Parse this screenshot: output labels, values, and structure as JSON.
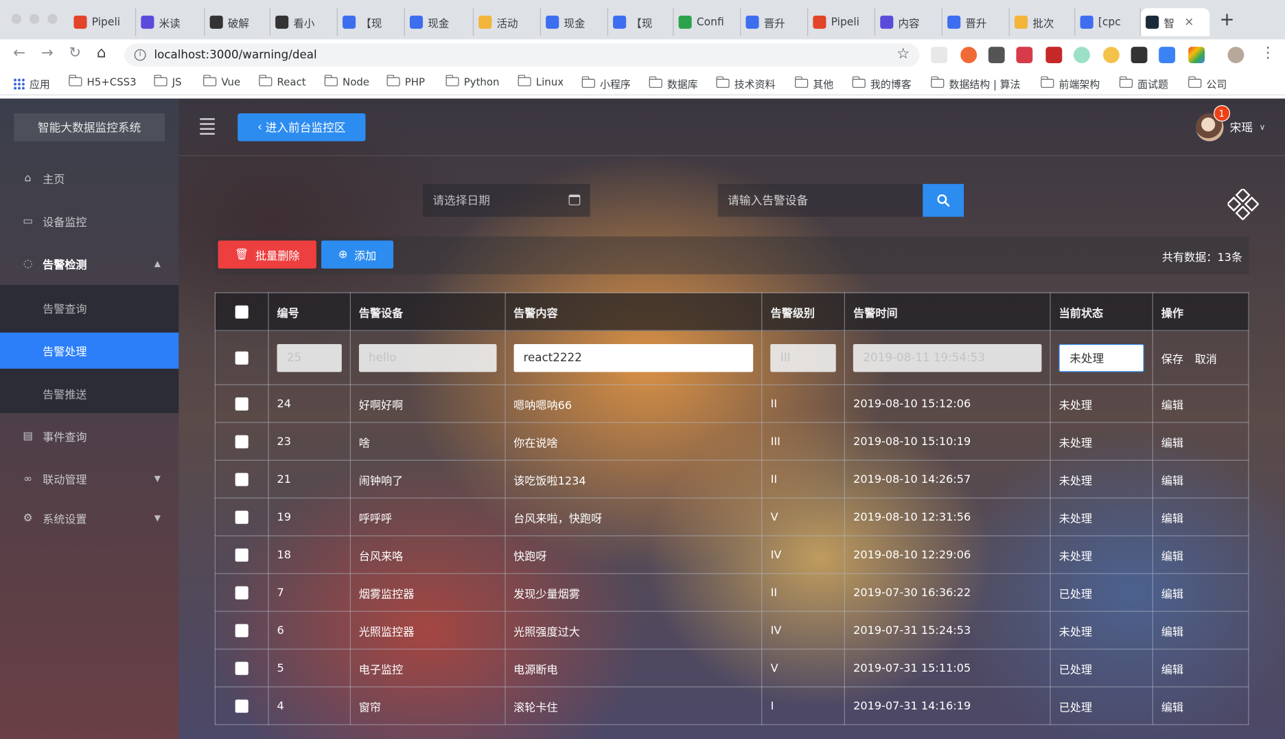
{
  "browser": {
    "tabs": [
      {
        "label": "Pipeli",
        "color": "#e24329"
      },
      {
        "label": "米读",
        "color": "#5b4bdb"
      },
      {
        "label": "破解",
        "color": "#333333"
      },
      {
        "label": "看小",
        "color": "#333333"
      },
      {
        "label": "【现",
        "color": "#3d6ef0"
      },
      {
        "label": "现金",
        "color": "#3d6ef0"
      },
      {
        "label": "活动",
        "color": "#f2b53a"
      },
      {
        "label": "现金",
        "color": "#3d6ef0"
      },
      {
        "label": "【现",
        "color": "#3d6ef0"
      },
      {
        "label": "Confi",
        "color": "#2ca24c"
      },
      {
        "label": "晋升",
        "color": "#3d6ef0"
      },
      {
        "label": "Pipeli",
        "color": "#e24329"
      },
      {
        "label": "内容",
        "color": "#5b4bdb"
      },
      {
        "label": "晋升",
        "color": "#3d6ef0"
      },
      {
        "label": "批次",
        "color": "#f2b53a"
      },
      {
        "label": "[cpc",
        "color": "#3d6ef0"
      },
      {
        "label": "智",
        "color": "#1c2b3a"
      }
    ],
    "url": "localhost:3000/warning/deal",
    "bookmarks": [
      "应用",
      "H5+CSS3",
      "JS",
      "Vue",
      "React",
      "Node",
      "PHP",
      "Python",
      "Linux",
      "小程序",
      "数据库",
      "技术资料",
      "其他",
      "我的博客",
      "数据结构 | 算法",
      "前端架构",
      "面试题",
      "公司"
    ]
  },
  "app": {
    "logo": "智能大数据监控系统",
    "menu": [
      {
        "label": "主页",
        "icon": "home-icon"
      },
      {
        "label": "设备监控",
        "icon": "video-icon"
      },
      {
        "label": "告警检测",
        "icon": "bell-icon"
      }
    ],
    "submenu": [
      "告警查询",
      "告警处理",
      "告警推送"
    ],
    "menu_after": [
      {
        "label": "事件查询",
        "icon": "document-icon"
      },
      {
        "label": "联动管理",
        "icon": "link-icon"
      },
      {
        "label": "系统设置",
        "icon": "gear-icon"
      }
    ],
    "header": {
      "front_button": "进入前台监控区",
      "user_name": "宋瑶",
      "badge_count": "1"
    },
    "filters": {
      "date_placeholder": "请选择日期",
      "device_placeholder": "请输入告警设备"
    },
    "actions": {
      "batch_delete": "批量删除",
      "add": "添加",
      "total": "共有数据：13条"
    },
    "table": {
      "columns": [
        "编号",
        "告警设备",
        "告警内容",
        "告警级别",
        "告警时间",
        "当前状态",
        "操作"
      ],
      "edit_row": {
        "id": "25",
        "device": "hello",
        "content": "react2222",
        "level": "III",
        "time": "2019-08-11 19:54:53",
        "status": "未处理",
        "save": "保存",
        "cancel": "取消"
      },
      "rows": [
        {
          "id": "24",
          "device": "好啊好啊",
          "content": "嗯呐嗯呐66",
          "level": "II",
          "time": "2019-08-10 15:12:06",
          "status": "未处理",
          "op": "编辑"
        },
        {
          "id": "23",
          "device": "啥",
          "content": "你在说啥",
          "level": "III",
          "time": "2019-08-10 15:10:19",
          "status": "未处理",
          "op": "编辑"
        },
        {
          "id": "21",
          "device": "闹钟响了",
          "content": "该吃饭啦1234",
          "level": "II",
          "time": "2019-08-10 14:26:57",
          "status": "未处理",
          "op": "编辑"
        },
        {
          "id": "19",
          "device": "呼呼呼",
          "content": "台风来啦，快跑呀",
          "level": "V",
          "time": "2019-08-10 12:31:56",
          "status": "未处理",
          "op": "编辑"
        },
        {
          "id": "18",
          "device": "台风来咯",
          "content": "快跑呀",
          "level": "IV",
          "time": "2019-08-10 12:29:06",
          "status": "未处理",
          "op": "编辑"
        },
        {
          "id": "7",
          "device": "烟雾监控器",
          "content": "发现少量烟雾",
          "level": "II",
          "time": "2019-07-30 16:36:22",
          "status": "已处理",
          "op": "编辑"
        },
        {
          "id": "6",
          "device": "光照监控器",
          "content": "光照强度过大",
          "level": "IV",
          "time": "2019-07-31 15:24:53",
          "status": "未处理",
          "op": "编辑"
        },
        {
          "id": "5",
          "device": "电子监控",
          "content": "电源断电",
          "level": "V",
          "time": "2019-07-31 15:11:05",
          "status": "已处理",
          "op": "编辑"
        },
        {
          "id": "4",
          "device": "窗帘",
          "content": "滚轮卡住",
          "level": "I",
          "time": "2019-07-31 14:16:19",
          "status": "已处理",
          "op": "编辑"
        }
      ]
    }
  }
}
